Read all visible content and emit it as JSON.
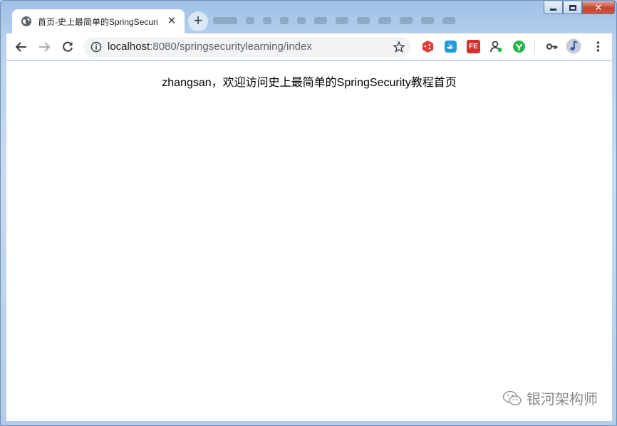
{
  "tab": {
    "title": "首页-史上最简单的SpringSecuri",
    "close_glyph": "✕"
  },
  "new_tab_glyph": "+",
  "address_bar": {
    "host": "localhost",
    "path": ":8080/springsecuritylearning/index"
  },
  "window_controls": {
    "close_glyph": "✕"
  },
  "extensions": [
    {
      "name": "dice-extension-icon",
      "color": "#e53935"
    },
    {
      "name": "swift-extension-icon",
      "color": "#1e9be0"
    },
    {
      "name": "fe-extension-icon",
      "color": "#d32f2f",
      "label": "FE"
    },
    {
      "name": "user-extension-icon",
      "color": "#3c4043"
    },
    {
      "name": "check-extension-icon",
      "color": "#25b34b"
    }
  ],
  "page": {
    "greeting": "zhangsan，欢迎访问史上最简单的SpringSecurity教程首页"
  },
  "watermark": {
    "text": "银河架构师"
  }
}
